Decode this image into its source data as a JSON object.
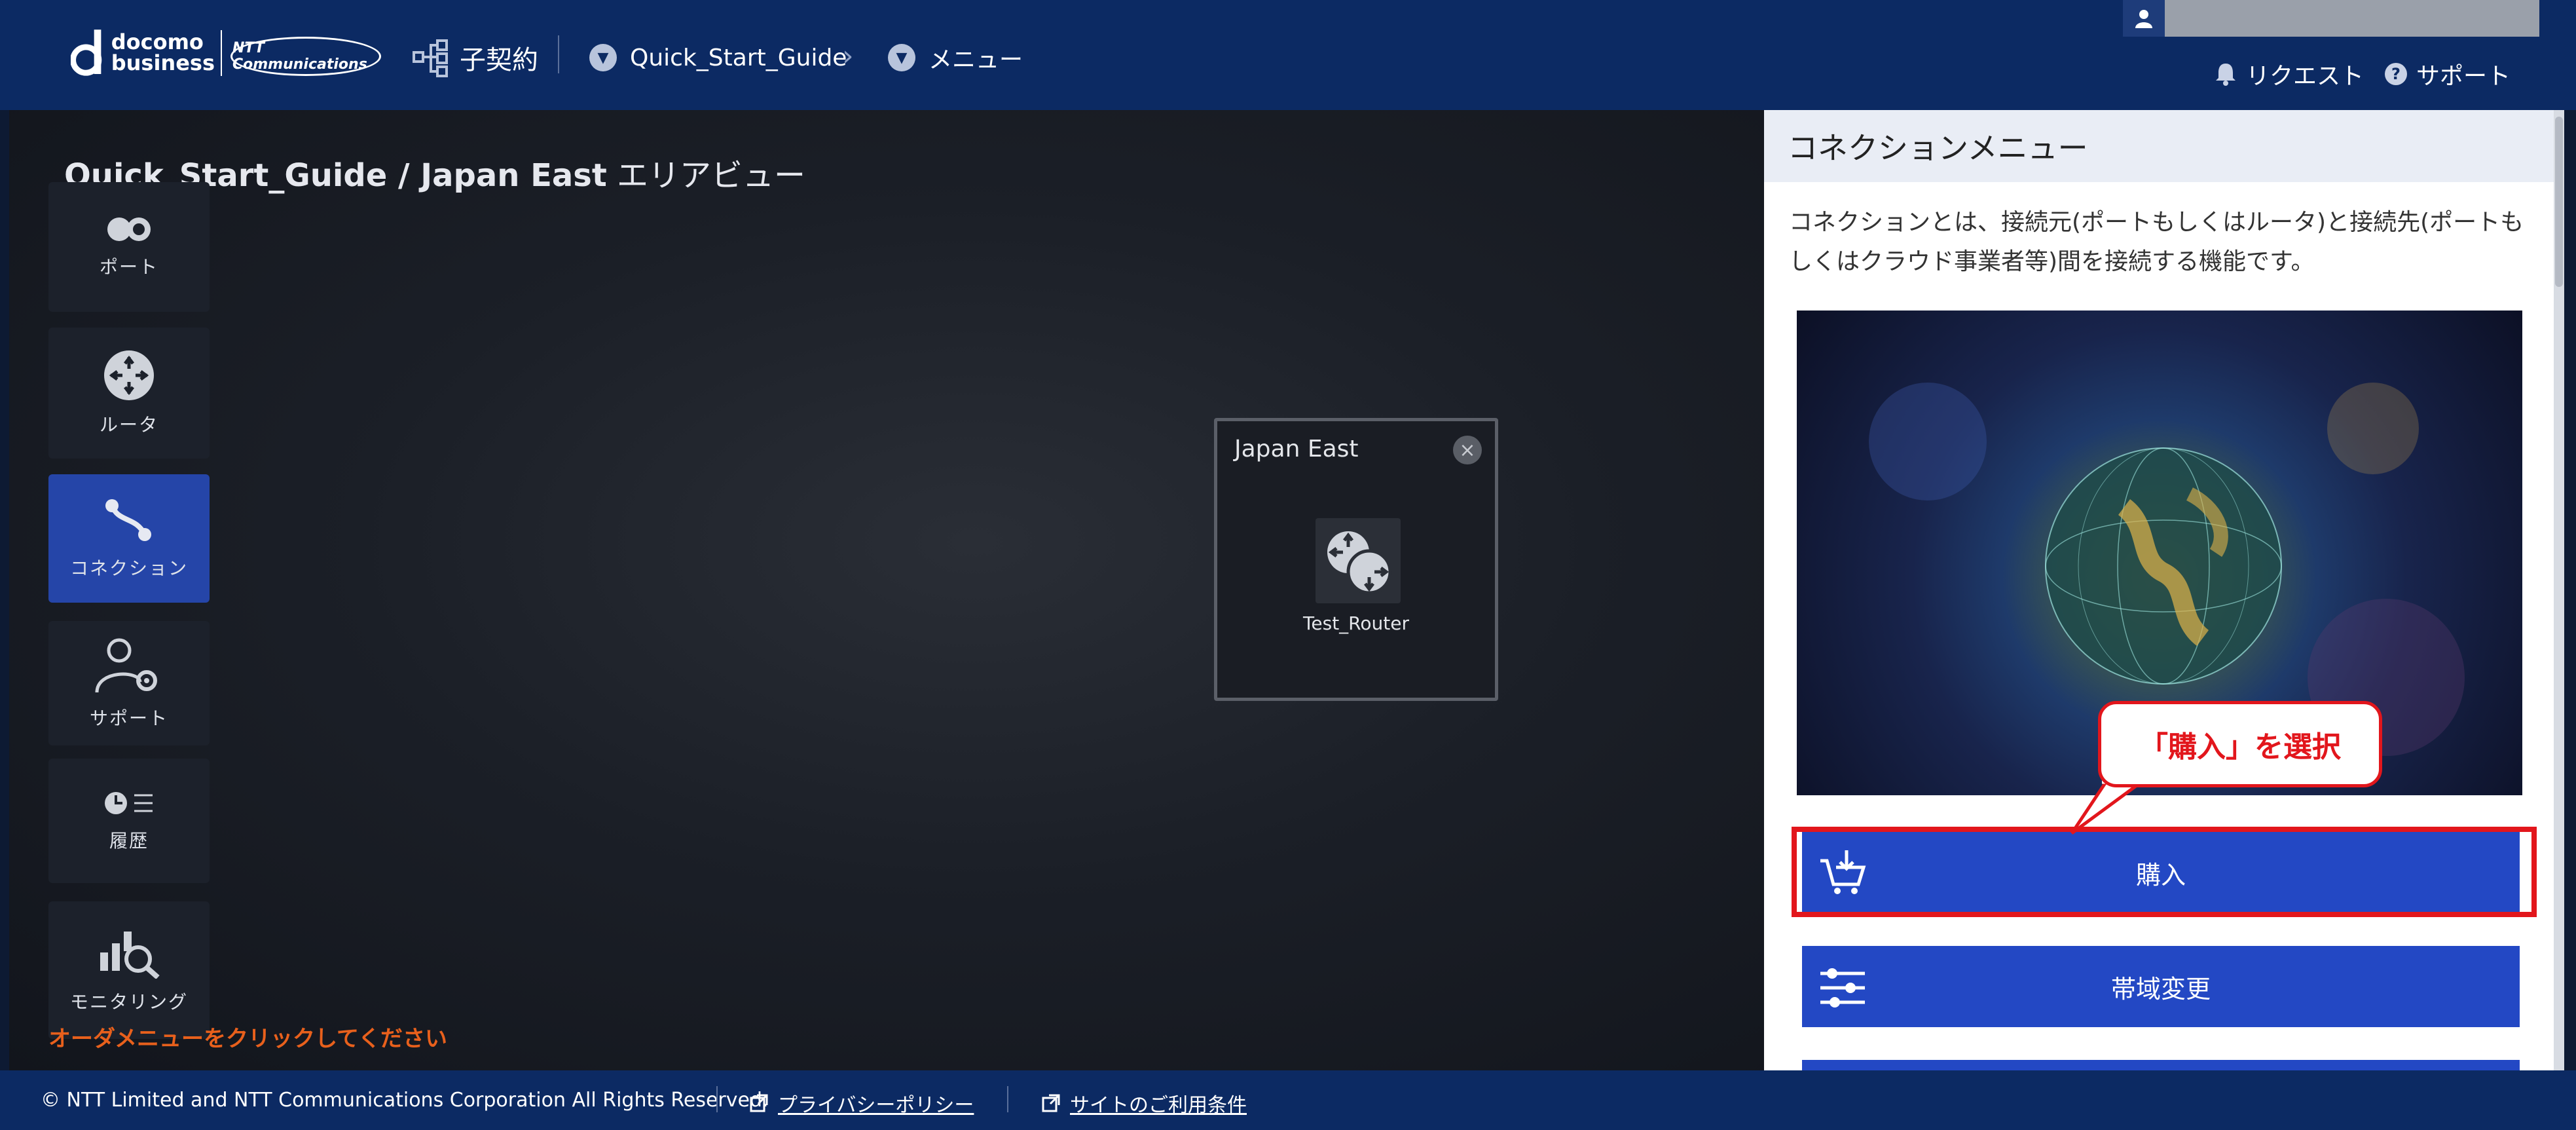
{
  "header": {
    "logo_line1": "docomo",
    "logo_line2": "business",
    "logo_ntt": "NTT Communications",
    "contract_label": "子契約",
    "breadcrumb": [
      "Quick_Start_Guide",
      "メニュー"
    ],
    "request_label": "リクエスト",
    "support_label": "サポート"
  },
  "canvas": {
    "title_main": "Quick_Start_Guide / Japan East",
    "title_suffix": " エリアビュー",
    "sidebar": [
      {
        "label": "ポート",
        "icon": "port-icon"
      },
      {
        "label": "ルータ",
        "icon": "router-icon"
      },
      {
        "label": "コネクション",
        "icon": "connection-icon",
        "active": true
      },
      {
        "label": "サポート",
        "icon": "support-user-icon"
      },
      {
        "label": "履歴",
        "icon": "history-icon"
      },
      {
        "label": "モニタリング",
        "icon": "monitoring-icon"
      }
    ],
    "hint": "オーダメニューをクリックしてください",
    "area": {
      "name": "Japan East",
      "router_name": "Test_Router"
    }
  },
  "panel": {
    "title": "コネクションメニュー",
    "description": "コネクションとは、接続元(ポートもしくはルータ)と接続先(ポートもしくはクラウド事業者等)間を接続する機能です。",
    "buttons": [
      {
        "label": "購入",
        "icon": "cart-icon"
      },
      {
        "label": "帯域変更",
        "icon": "sliders-icon"
      }
    ],
    "callout": "「購入」を選択"
  },
  "footer": {
    "copyright": "© NTT Limited and NTT Communications Corporation All Rights Reserved.",
    "privacy": "プライバシーポリシー",
    "terms": "サイトのご利用条件"
  },
  "colors": {
    "header_bg": "#0c2a63",
    "accent_blue": "#2348c4",
    "highlight_red": "#e2161c",
    "hint_orange": "#e8601c"
  }
}
